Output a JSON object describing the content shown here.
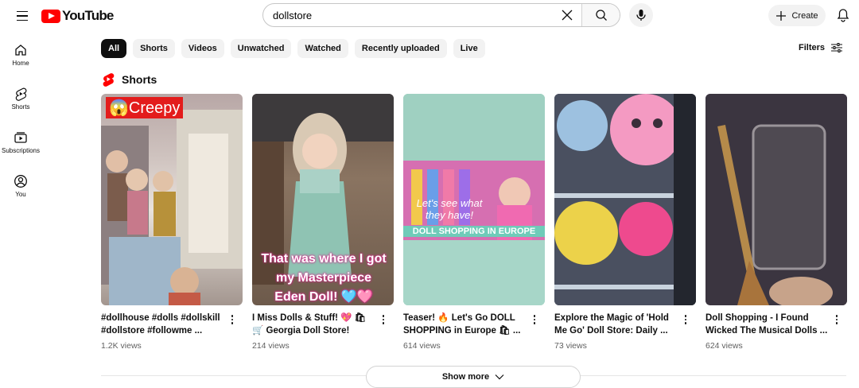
{
  "header": {
    "logo_text": "YouTube",
    "search_value": "dollstore",
    "create_label": "Create"
  },
  "sidebar": {
    "items": [
      {
        "label": "Home"
      },
      {
        "label": "Shorts"
      },
      {
        "label": "Subscriptions"
      },
      {
        "label": "You"
      }
    ]
  },
  "chips": [
    "All",
    "Shorts",
    "Videos",
    "Unwatched",
    "Watched",
    "Recently uploaded",
    "Live"
  ],
  "filters_label": "Filters",
  "section": {
    "title": "Shorts"
  },
  "shorts": [
    {
      "title": "#dollhouse #dolls #dollskill #dollstore #followme ...",
      "views": "1.2K views",
      "overlay": "😱Creepy"
    },
    {
      "title": "I Miss Dolls & Stuff! 💖 🛍 🛒 Georgia Doll Store!",
      "views": "214 views",
      "overlay": "That was where I got my Masterpiece Eden Doll! 🩵🩷"
    },
    {
      "title": "Teaser! 🔥 Let's Go DOLL SHOPPING in Europe 🛍 ...",
      "views": "614 views",
      "overlay_a": "Let's see what they have!",
      "overlay_b": "DOLL SHOPPING IN EUROPE"
    },
    {
      "title": "Explore the Magic of 'Hold Me Go' Doll Store: Daily ...",
      "views": "73 views"
    },
    {
      "title": "Doll Shopping - I Found Wicked The Musical Dolls ...",
      "views": "624 views"
    }
  ],
  "show_more_label": "Show more",
  "colors": {
    "brand_red": "#ff0000",
    "chip_bg": "#f2f2f2",
    "chip_active": "#0f0f0f"
  }
}
